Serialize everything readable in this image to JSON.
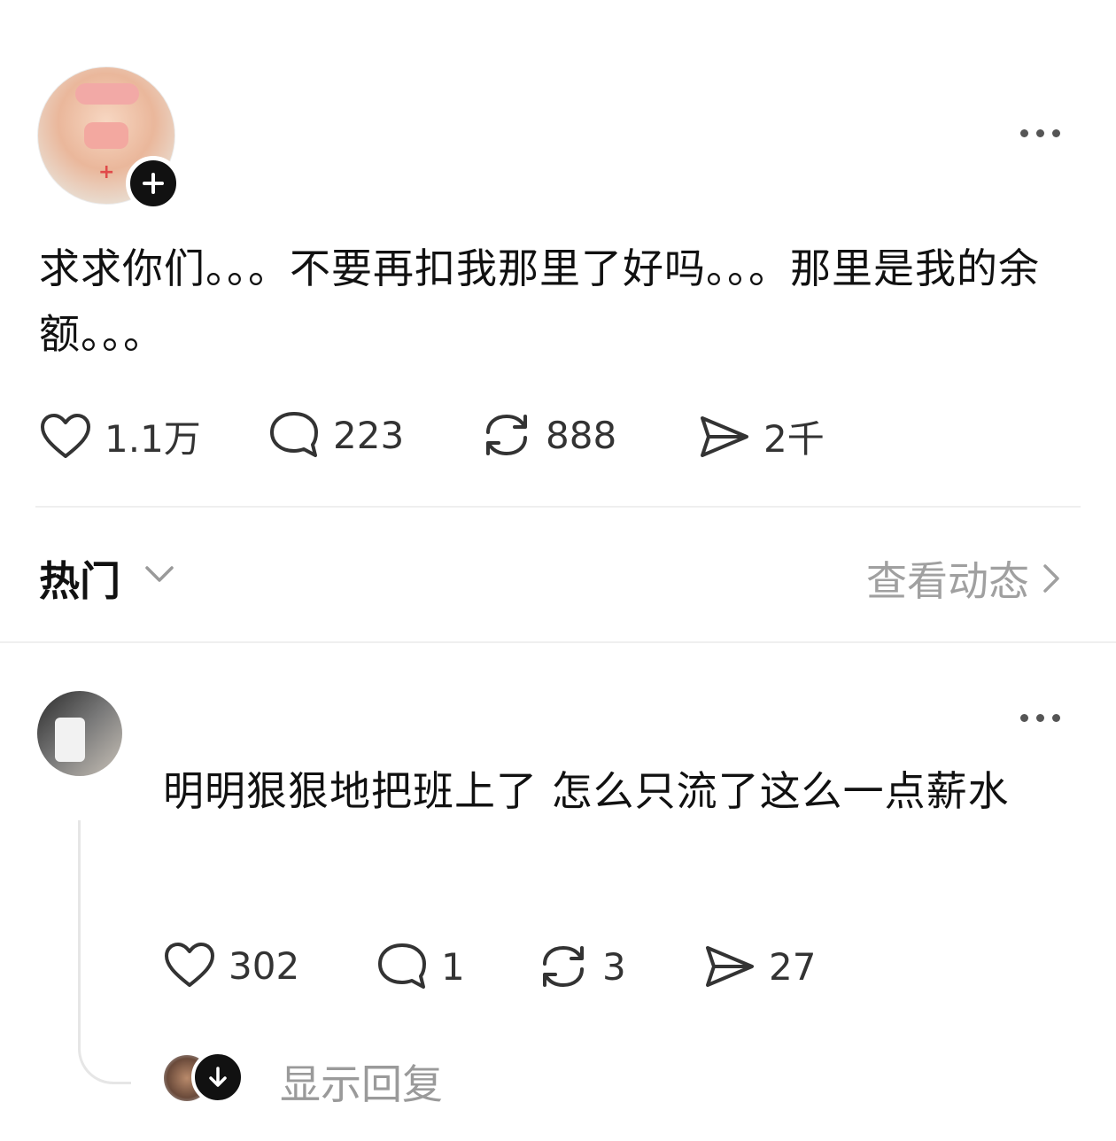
{
  "post": {
    "text": "求求你们。。。不要再扣我那里了好吗。。。那里是我的余额。。。",
    "actions": {
      "likes": "1.1万",
      "comments": "223",
      "reposts": "888",
      "shares": "2千"
    }
  },
  "section": {
    "sort_label": "热门",
    "view_activity_label": "查看动态"
  },
  "comment": {
    "text": "明明狠狠地把班上了 怎么只流了这么一点薪水",
    "actions": {
      "likes": "302",
      "comments": "1",
      "reposts": "3",
      "shares": "27"
    },
    "show_replies_label": "显示回复"
  },
  "icons": {
    "post_more": "more-horizontal-icon",
    "follow": "plus-icon",
    "like": "heart-icon",
    "comment": "speech-bubble-icon",
    "repost": "repost-arrows-icon",
    "share": "paper-plane-icon",
    "sort_dropdown": "chevron-down-icon",
    "view_activity": "chevron-right-icon",
    "reply_expand": "arrow-down-icon"
  },
  "colors": {
    "text_primary": "#111111",
    "text_secondary": "#9a9a9a",
    "badge": "#111111"
  }
}
